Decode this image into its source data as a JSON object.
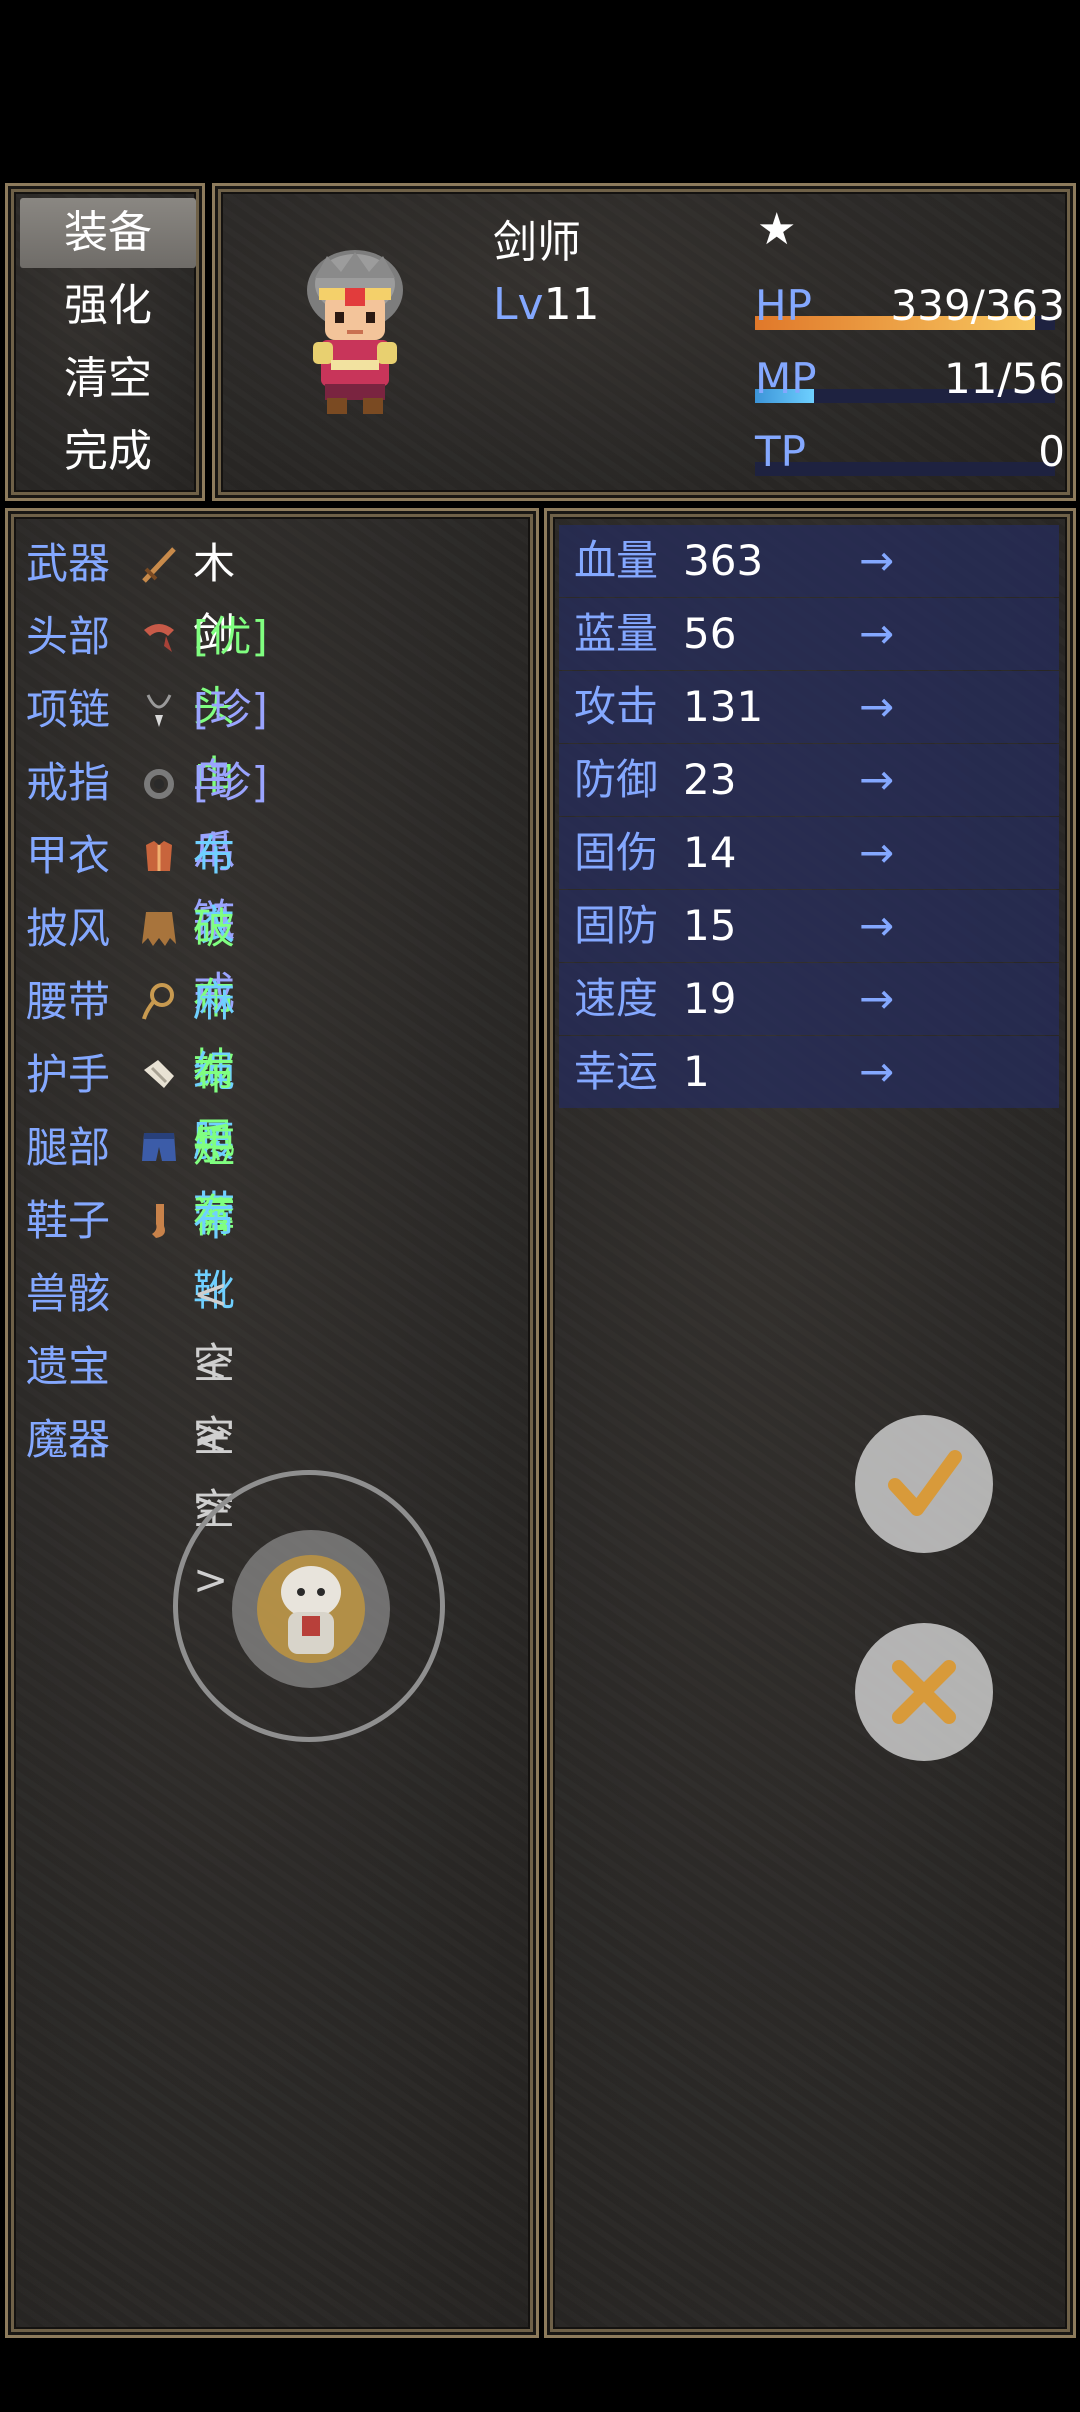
{
  "menu": {
    "items": [
      {
        "label": "装备",
        "selected": true
      },
      {
        "label": "强化",
        "selected": false
      },
      {
        "label": "清空",
        "selected": false
      },
      {
        "label": "完成",
        "selected": false
      }
    ]
  },
  "actor": {
    "class_name": "剑师",
    "level_label": "Lv",
    "level": "11",
    "star": "★",
    "hp_label": "HP",
    "hp_value": "339/363",
    "hp_ratio": 0.934,
    "mp_label": "MP",
    "mp_value": "11/56",
    "mp_ratio": 0.196,
    "tp_label": "TP",
    "tp_value": "0",
    "tp_ratio": 0,
    "colors": {
      "hp": "#f0902e",
      "mp": "#4aa6e8",
      "label": "#84a8ff"
    }
  },
  "equipment": [
    {
      "slot": "武器",
      "name": "木剑",
      "color": "white",
      "icon": "wooden-sword-icon"
    },
    {
      "slot": "头部",
      "name": "[优]头巾",
      "color": "green",
      "icon": "headscarf-icon"
    },
    {
      "slot": "项链",
      "name": "[珍]鸟爪链",
      "color": "blue",
      "icon": "claw-necklace-icon"
    },
    {
      "slot": "戒指",
      "name": "[珍]鸟爪戒",
      "color": "blue",
      "icon": "claw-ring-icon"
    },
    {
      "slot": "甲衣",
      "name": "布衣",
      "color": "cyan",
      "icon": "cloth-armor-icon"
    },
    {
      "slot": "披风",
      "name": "破布披风",
      "color": "green",
      "icon": "ragged-cape-icon"
    },
    {
      "slot": "腰带",
      "name": "麻绳腰带",
      "color": "cyan",
      "icon": "rope-belt-icon"
    },
    {
      "slot": "护手",
      "name": "布手套",
      "color": "green",
      "icon": "cloth-gloves-icon"
    },
    {
      "slot": "腿部",
      "name": "短裤",
      "color": "green",
      "icon": "shorts-icon"
    },
    {
      "slot": "鞋子",
      "name": "布靴",
      "color": "cyan",
      "icon": "cloth-boots-icon"
    },
    {
      "slot": "兽骸",
      "name": "<空>",
      "color": "empty",
      "icon": ""
    },
    {
      "slot": "遗宝",
      "name": "<空>",
      "color": "empty",
      "icon": ""
    },
    {
      "slot": "魔器",
      "name": "<空>",
      "color": "empty",
      "icon": ""
    }
  ],
  "params": [
    {
      "name": "血量",
      "value": "363",
      "arrow": "→"
    },
    {
      "name": "蓝量",
      "value": "56",
      "arrow": "→"
    },
    {
      "name": "攻击",
      "value": "131",
      "arrow": "→"
    },
    {
      "name": "防御",
      "value": "23",
      "arrow": "→"
    },
    {
      "name": "固伤",
      "value": "14",
      "arrow": "→"
    },
    {
      "name": "固防",
      "value": "15",
      "arrow": "→"
    },
    {
      "name": "速度",
      "value": "19",
      "arrow": "→"
    },
    {
      "name": "幸运",
      "value": "1",
      "arrow": "→"
    }
  ],
  "buttons": {
    "confirm_icon": "check-icon",
    "cancel_icon": "cross-icon",
    "joystick_icon": "companion-avatar-icon"
  }
}
